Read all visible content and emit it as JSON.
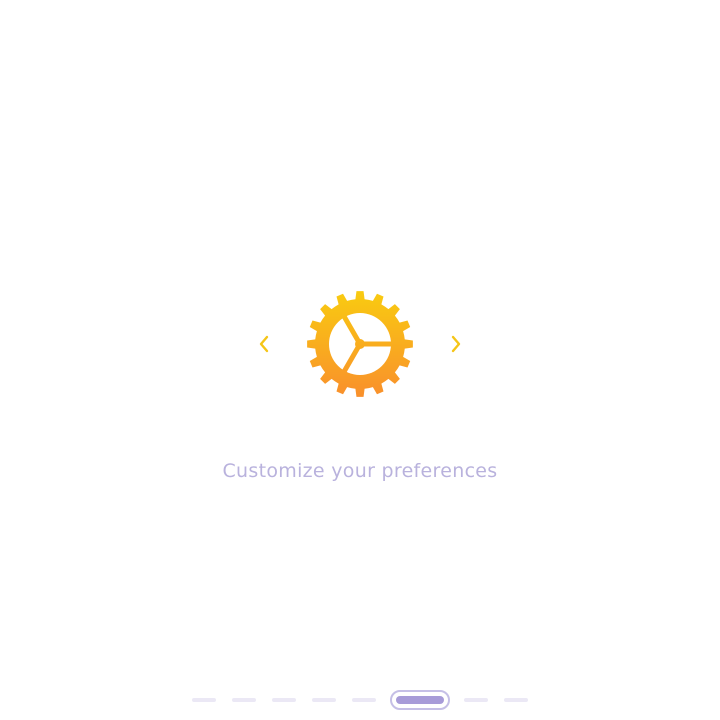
{
  "carousel": {
    "prev_icon": "chevron-left-icon",
    "next_icon": "chevron-right-icon",
    "slide_icon": "gear-icon",
    "caption": "Customize your preferences"
  },
  "pager": {
    "total": 8,
    "active_index": 5
  },
  "colors": {
    "arrow": "#f5c518",
    "gear_top": "#f9cc10",
    "gear_bottom": "#f98f2c",
    "caption": "#b9b2dd",
    "dot": "#ebe8f5",
    "dot_active_fill": "#a79bd8",
    "dot_active_border": "#c5bfe6"
  }
}
